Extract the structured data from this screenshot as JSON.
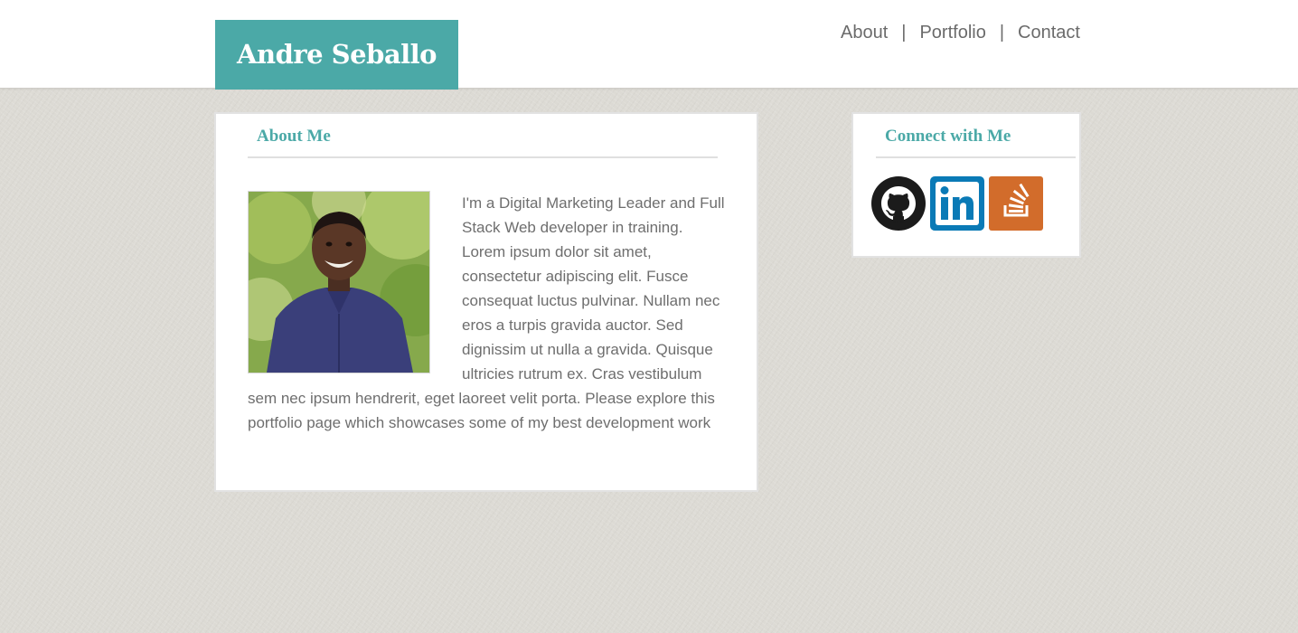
{
  "header": {
    "brand": "Andre Seballo",
    "nav": [
      {
        "label": "About"
      },
      {
        "label": "Portfolio"
      },
      {
        "label": "Contact"
      }
    ],
    "separator": "|"
  },
  "about": {
    "title": "About Me",
    "photo_alt": "Portrait photo",
    "body": "I'm a Digital Marketing Leader and Full Stack Web developer in training. Lorem ipsum dolor sit amet, consectetur adipiscing elit. Fusce consequat luctus pulvinar. Nullam nec eros a turpis gravida auctor. Sed dignissim ut nulla a gravida. Quisque ultricies rutrum ex. Cras vestibulum sem nec ipsum hendrerit, eget laoreet velit porta. Please explore this portfolio page which showcases some of my best development work"
  },
  "connect": {
    "title": "Connect with Me",
    "icons": [
      {
        "name": "github-icon",
        "color": "#1b1b1b"
      },
      {
        "name": "linkedin-icon",
        "color": "#0a7ab6"
      },
      {
        "name": "stackoverflow-icon",
        "color": "#d26c2b"
      }
    ]
  },
  "colors": {
    "accent": "#4ba9a7",
    "text": "#6e6e6e",
    "nav_text": "#6b6b6b"
  }
}
